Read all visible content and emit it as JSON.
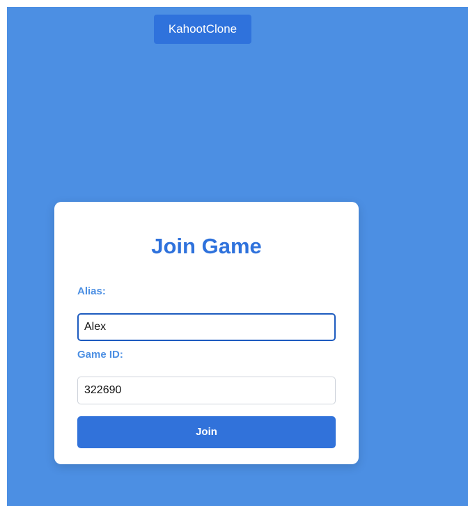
{
  "header": {
    "brand_label": "KahootClone"
  },
  "join_form": {
    "title": "Join Game",
    "alias_label": "Alias:",
    "alias_value": "Alex",
    "game_id_label": "Game ID:",
    "game_id_value": "322690",
    "join_label": "Join"
  },
  "colors": {
    "page_background": "#4c8fe3",
    "primary": "#2f72dc",
    "label": "#4c8fe3",
    "card": "#ffffff"
  }
}
